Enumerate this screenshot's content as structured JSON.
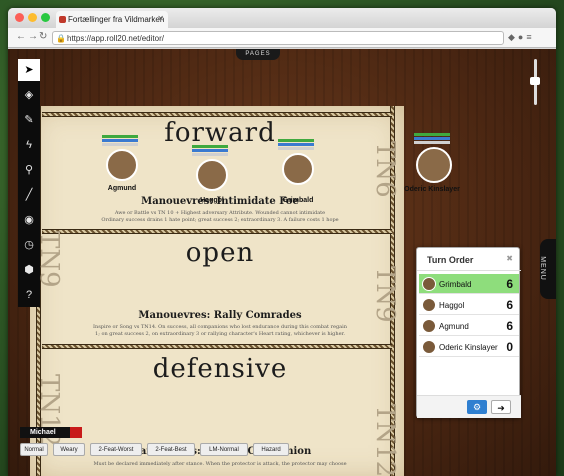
{
  "browser": {
    "tab_title": "Fortællinger fra Vildmarken",
    "url": "https://app.roll20.net/editor/"
  },
  "app": {
    "pages_label": "PAGES",
    "menu_label": "MENU"
  },
  "map": {
    "sections": [
      {
        "title": "forward",
        "subtitle": "Manouevres: Intimidate Foe",
        "lines": [
          "Awe or Battle vs TN 10 + Highest adversary Attribute. Wounded cannot intimidate",
          "Ordinary success drains 1 hate point; great success 2; extraordinary 3. A failure costs 1 hope"
        ]
      },
      {
        "title": "open",
        "subtitle": "Manouevres: Rally Comrades",
        "lines": [
          "Inspire or Song vs TN14. On success, all companions who lost endurance during this combat regain",
          "1; on great success 2, on extraordinary 3 or rallying character's Heart rating, whichever is higher."
        ]
      },
      {
        "title": "defensive",
        "subtitle": "Manouevres: Defend Companion",
        "lines": [
          "Must be declared immediately after stance. When the protector is attack, the protector may choose"
        ]
      }
    ],
    "tn_labels": [
      "TN6",
      "TN9",
      "TN9",
      "TN12",
      "TN12"
    ]
  },
  "tokens": [
    {
      "name": "Agmund"
    },
    {
      "name": "Haggol"
    },
    {
      "name": "Grimbald"
    },
    {
      "name": "Oderic Kinslayer"
    }
  ],
  "turn_order": {
    "title": "Turn Order",
    "entries": [
      {
        "name": "Grimbald",
        "score": "6",
        "current": true
      },
      {
        "name": "Haggol",
        "score": "6",
        "current": false
      },
      {
        "name": "Agmund",
        "score": "6",
        "current": false
      },
      {
        "name": "Oderic Kinslayer",
        "score": "0",
        "current": false
      }
    ]
  },
  "player": {
    "name": "Michael",
    "color": "#c81a1a"
  },
  "macros": [
    "Normal",
    "Weary",
    "2-Feat-Worst",
    "2-Feat-Best",
    "LM-Normal",
    "Hazard"
  ],
  "colors": {
    "accent": "#2f7fd0",
    "current_turn": "#8edd7c"
  },
  "icons": [
    "select-icon",
    "map-layer-icon",
    "draw-icon",
    "fx-icon",
    "zoom-icon",
    "ruler-icon",
    "fog-icon",
    "turn-tracker-icon",
    "dice-icon",
    "help-icon"
  ]
}
